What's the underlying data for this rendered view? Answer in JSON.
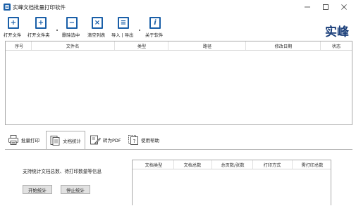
{
  "window": {
    "title": "实峰文档批量打印软件",
    "minimize_glyph": "—",
    "maximize_glyph": "☐",
    "close_glyph": "✕"
  },
  "toolbar": {
    "brand": "实峰",
    "buttons": [
      {
        "label": "打开文件",
        "icon": "add-file-icon",
        "glyph": "+"
      },
      {
        "label": "打开文件夹",
        "icon": "add-folder-icon",
        "glyph": "+"
      },
      {
        "label": "删除选中",
        "icon": "remove-icon",
        "glyph": "−"
      },
      {
        "label": "清空列表",
        "icon": "clear-list-icon",
        "glyph": "×"
      },
      {
        "label": "导入 | 导出",
        "icon": "import-export-icon",
        "glyph": "≡"
      },
      {
        "label": "关于软件",
        "icon": "info-icon",
        "glyph": "i"
      }
    ]
  },
  "file_list": {
    "columns": [
      "序号",
      "文件名",
      "类型",
      "路径",
      "修改日期",
      "状态"
    ],
    "rows": []
  },
  "tabs": [
    {
      "label": "批量打印",
      "icon": "printer-icon",
      "active": false
    },
    {
      "label": "文档统计",
      "icon": "document-stats-icon",
      "active": true
    },
    {
      "label": "转为PDF",
      "icon": "convert-pdf-icon",
      "active": false
    },
    {
      "label": "使用帮助",
      "icon": "help-icon",
      "active": false
    }
  ],
  "stats_panel": {
    "description": "支持统计文档总数、待打印数量等信息",
    "start_button": "开始统计",
    "stop_button": "停止统计",
    "columns": [
      "文档类型",
      "文档总数",
      "总页数/张数",
      "打印方式",
      "需打印总数"
    ],
    "rows": []
  },
  "colors": {
    "accent": "#1a5fa8",
    "brand": "#1b3f7a",
    "border": "#a9a9a9",
    "button_bg": "#e1e1e1"
  }
}
